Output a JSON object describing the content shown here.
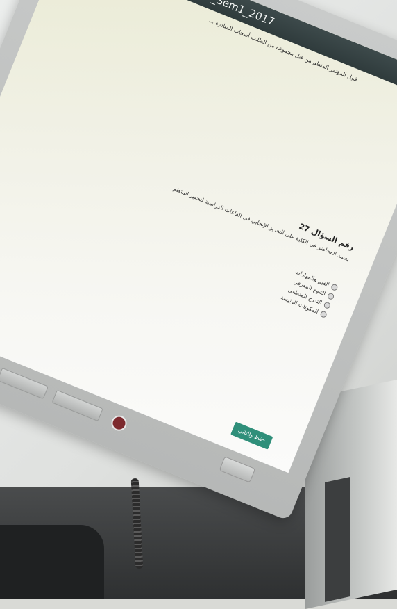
{
  "window": {
    "title": "_Sem1_2017"
  },
  "header": {
    "top_text": "قبيل المؤتمر المنظم من قبل مجموعة من الطلاب أصحاب المبادرة ..."
  },
  "question": {
    "title": "رقم السؤال 27",
    "body": "يعتمد المحاضر في الكلية على التعزيز الإيجابي في القاعات الدراسية لتحفيز المتعلم",
    "options": [
      {
        "label": "القيم والمهارات"
      },
      {
        "label": "التنوع المعرفي"
      },
      {
        "label": "التدرج المنطقي"
      },
      {
        "label": "المكونات الرئيسة"
      }
    ]
  },
  "footer": {
    "next_button": "حفظ والتالي"
  },
  "colors": {
    "accent": "#2f8f7a",
    "titlebar": "#3d4a4b"
  }
}
